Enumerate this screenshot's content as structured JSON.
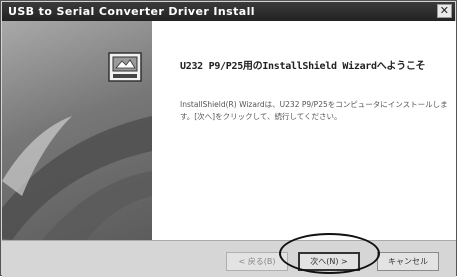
{
  "window": {
    "title": "USB to Serial Converter Driver Install",
    "close_label": "✕"
  },
  "content": {
    "heading": "U232 P9/P25用のInstallShield Wizardへようこそ",
    "description": "InstallShield(R) Wizardは、U232 P9/P25をコンピュータにインストールします。[次へ]をクリックして、続行してください。"
  },
  "buttons": {
    "back": "< 戻る(B)",
    "next": "次へ(N) >",
    "cancel": "キャンセル"
  },
  "icons": {
    "setup": "installer-setup-icon",
    "graphic": "wizard-arcs-graphic"
  }
}
